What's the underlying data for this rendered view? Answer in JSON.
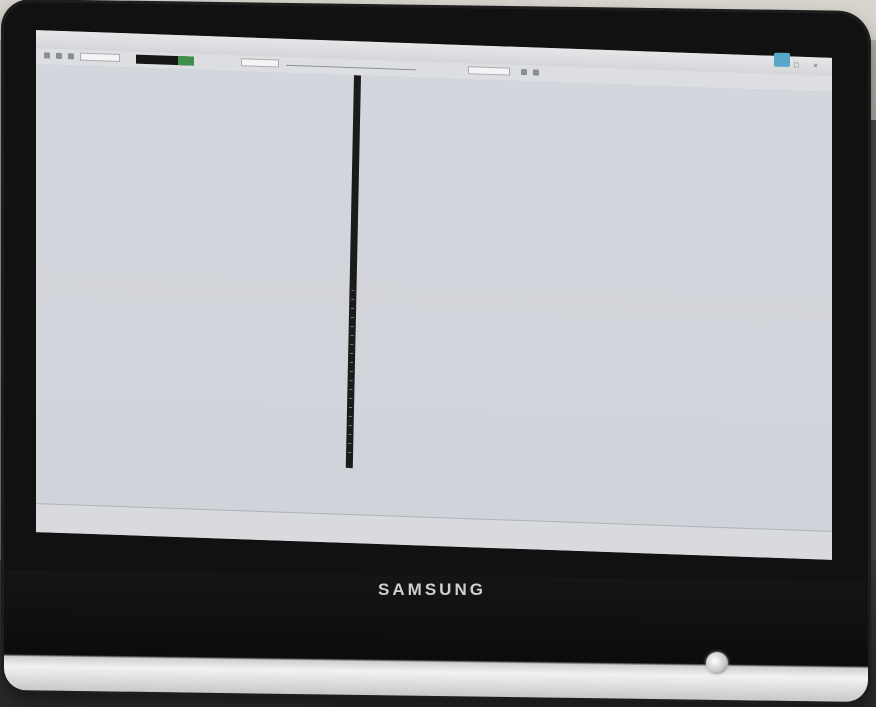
{
  "scene": {
    "brand": "SAMSUNG"
  },
  "app": {
    "window_title": "",
    "menu": [],
    "toolbar": {
      "time_value": "",
      "field_a": "",
      "field_b": "",
      "field_c": ""
    },
    "status_text": "",
    "side_label": ""
  },
  "colors": {
    "screen_bg": "#d3d6dc",
    "tower": "#1b1b1b",
    "time_green": "#3f8f4a",
    "bezel": "#111111"
  },
  "icons": [
    "window-controls-icon",
    "toolbar-icon",
    "corner-widget-icon"
  ]
}
